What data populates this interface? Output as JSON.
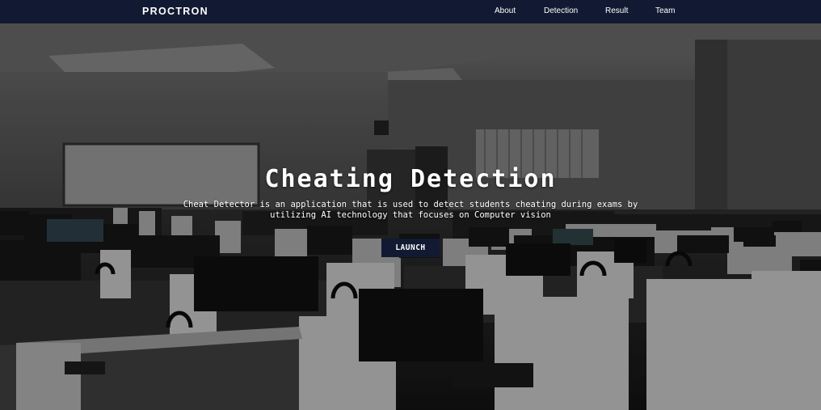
{
  "nav": {
    "brand": "PROCTRON",
    "links": [
      "About",
      "Detection",
      "Result",
      "Team"
    ]
  },
  "hero": {
    "title": "Cheating Detection",
    "subtitle": "Cheat Detector is an application that is used to detect students cheating during exams by utilizing AI technology that focuses on Computer vision",
    "button_label": "LAUNCH",
    "background": "grayscale photo of a computer lab with rows of desks, monitors and headphones"
  },
  "colors": {
    "nav_bg": "#121a33",
    "button_bg": "#121a33",
    "text": "#ffffff"
  }
}
